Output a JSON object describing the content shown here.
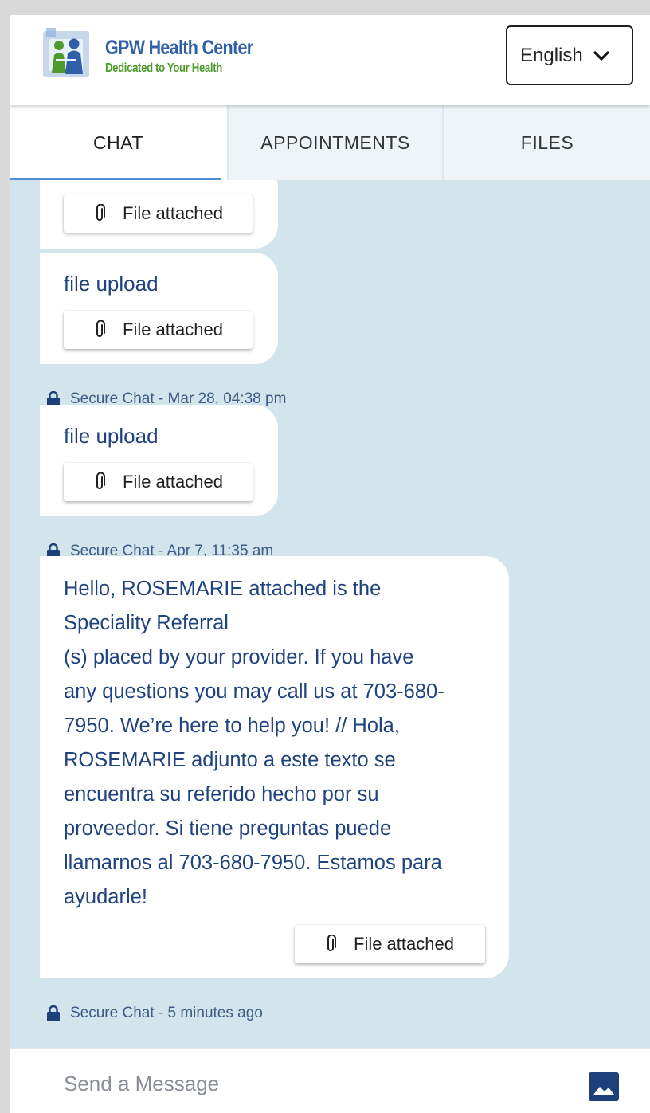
{
  "header": {
    "brand_name": "GPW Health Center",
    "brand_tagline": "Dedicated to Your Health",
    "language_label": "English"
  },
  "tabs": [
    {
      "label": "CHAT",
      "active": true
    },
    {
      "label": "APPOINTMENTS",
      "active": false
    },
    {
      "label": "FILES",
      "active": false
    }
  ],
  "messages": [
    {
      "text": "",
      "attachment": "File attached"
    },
    {
      "text": "file upload",
      "attachment": "File attached",
      "meta": "Secure Chat - Mar 28, 04:38 pm"
    },
    {
      "text": "file upload",
      "attachment": "File attached",
      "meta": "Secure Chat - Apr 7, 11:35 am"
    },
    {
      "lines": [
        "Hello,  ROSEMARIE  attached is the",
        "Speciality Referral",
        "(s) placed by your provider. If you have",
        "any questions you may call us at 703-680-",
        "7950. We’re here to help you! // Hola,",
        "ROSEMARIE adjunto a este texto se",
        "encuentra su referido hecho por su",
        "proveedor. Si tiene preguntas puede",
        "llamarnos al 703-680-7950. Estamos para",
        "ayudarle!"
      ],
      "attachment": "File attached",
      "meta": "Secure Chat - 5 minutes ago"
    }
  ],
  "composer": {
    "placeholder": "Send a Message"
  },
  "colors": {
    "accent": "#4a8fd1",
    "chat_bg": "#d3e5ec",
    "text_blue": "#1f437e",
    "brand_blue": "#2f5fa6",
    "brand_green": "#4f9a2c"
  },
  "icons": {
    "attachment": "paperclip-icon",
    "lock": "lock-icon",
    "image": "image-icon",
    "dropdown": "chevron-down-icon"
  }
}
